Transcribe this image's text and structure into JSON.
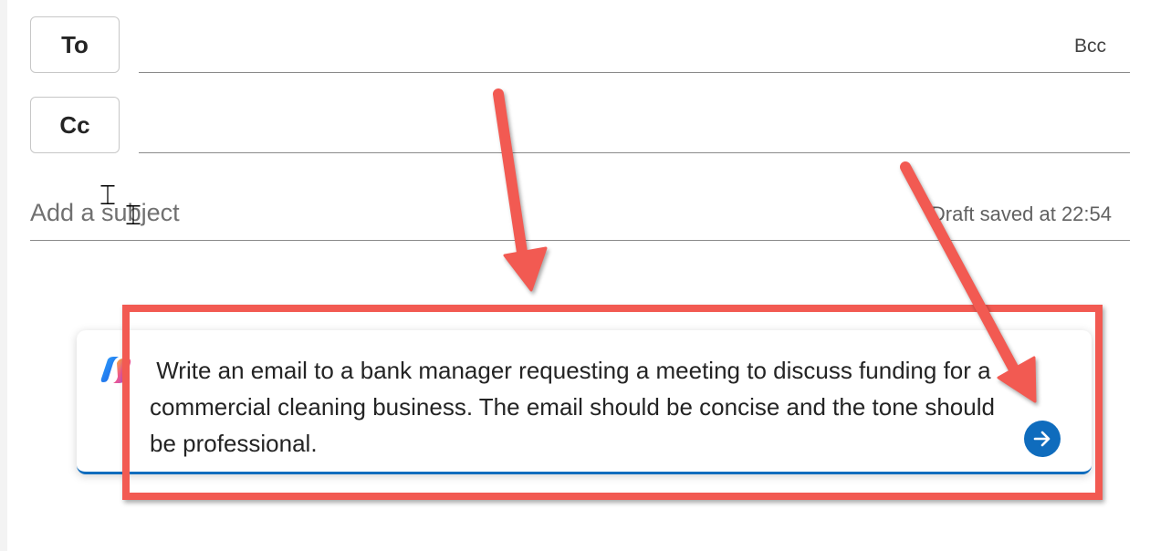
{
  "compose": {
    "to_label": "To",
    "cc_label": "Cc",
    "bcc_label": "Bcc",
    "subject_placeholder": "Add a subject",
    "draft_status": "Draft saved at 22:54"
  },
  "copilot": {
    "icon": "copilot-icon",
    "prompt": " Write an email to a bank manager requesting a meeting to discuss funding for a commercial cleaning business. The email should be concise and the tone should be professional.",
    "send_icon": "arrow-right-icon"
  },
  "colors": {
    "accent": "#0f6cbd",
    "annotation": "#f25a52"
  }
}
